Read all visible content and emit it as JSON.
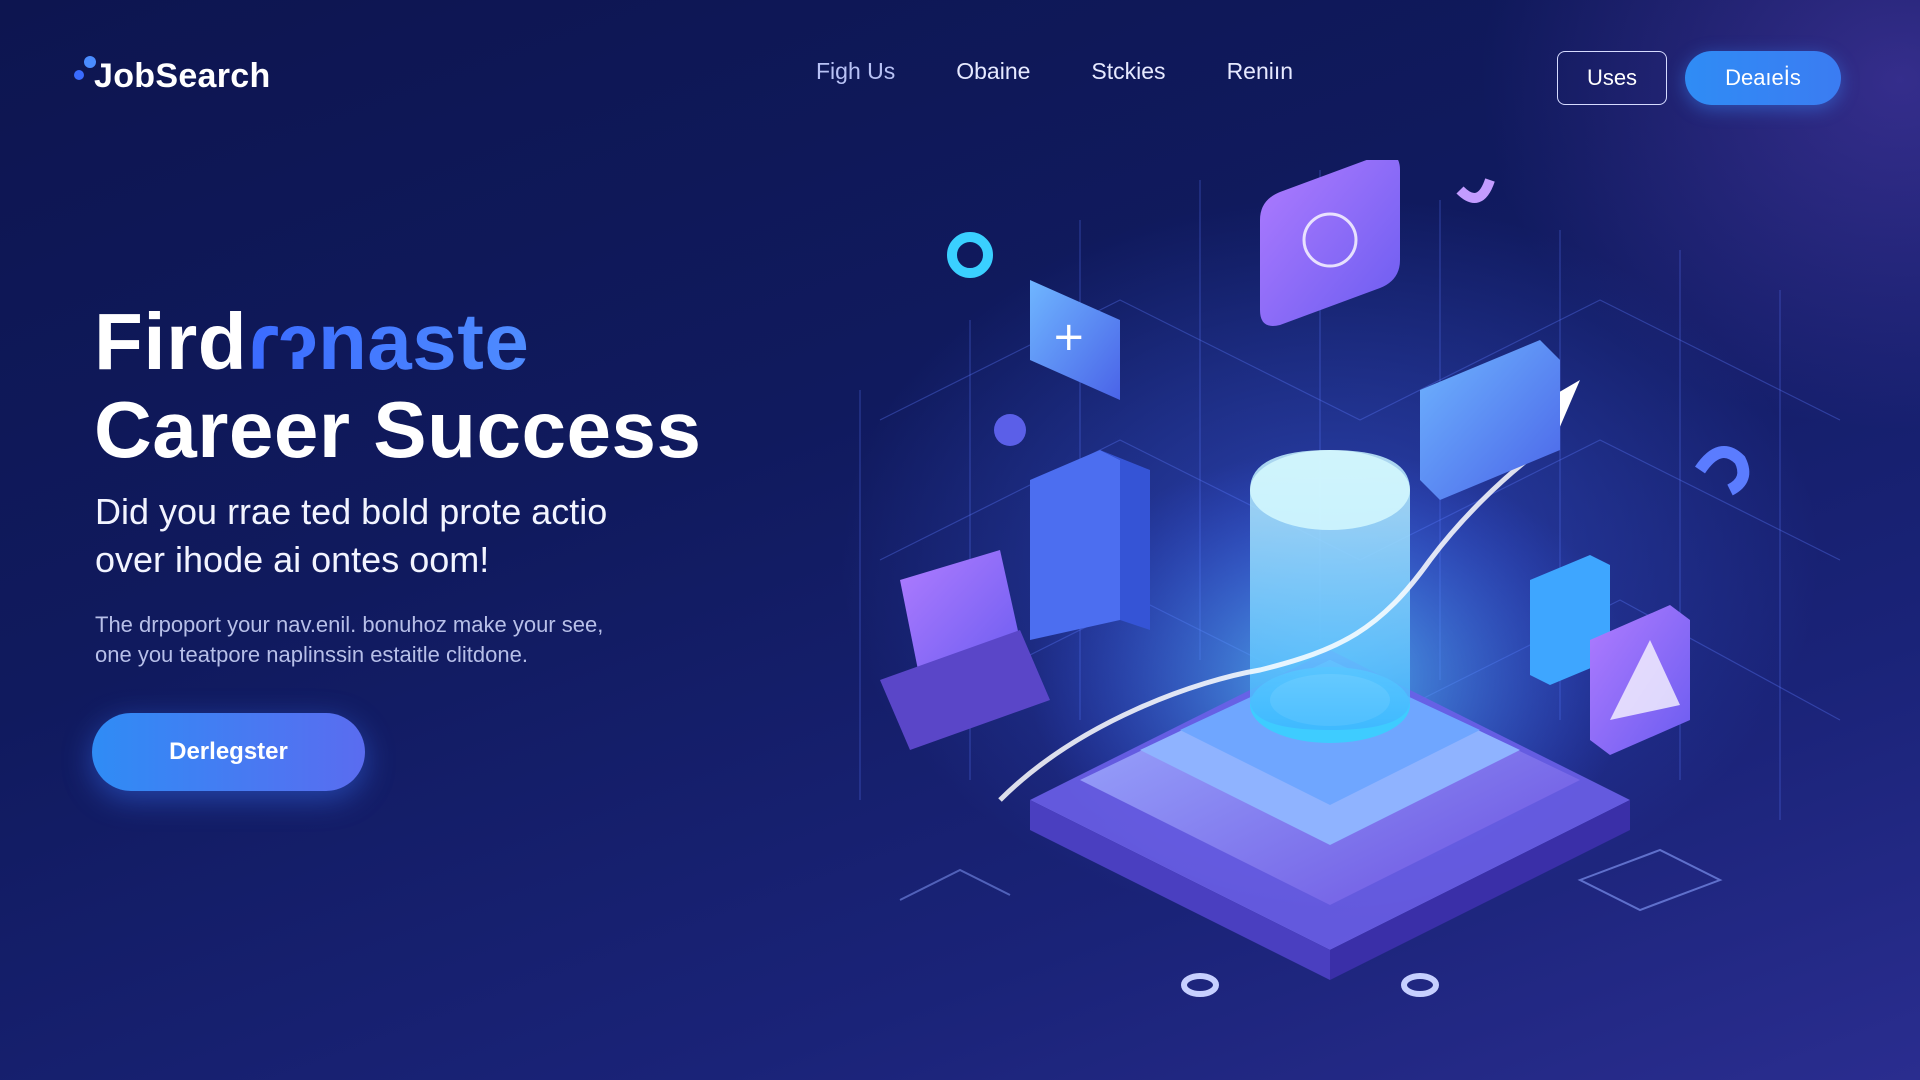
{
  "header": {
    "logo_text": "JobSearch",
    "nav": [
      "Figh Us",
      "Obaine",
      "Stckies",
      "Reniın"
    ],
    "outline_button": "Uses",
    "primary_button": "Deaıeİs"
  },
  "hero": {
    "title_line1_plain": "Fird",
    "title_line1_highlight": "ɾɂnaste",
    "title_line2": "Career Success",
    "subtitle_line1": "Did you rrae ted bold prote actio",
    "subtitle_line2": "over ihode ai ontes oom!",
    "body_line1": "The drpoport your  nav.enil. bonuhoz make your see,",
    "body_line2": "one you teatpore naplinssin estaitle clitdone.",
    "cta_label": "Derlegster"
  },
  "colors": {
    "accent": "#3b7cf2",
    "highlight": "#4f8cff",
    "background": "#101a5e"
  },
  "icons": [
    "logo-dots-icon",
    "isometric-platform-illustration"
  ]
}
